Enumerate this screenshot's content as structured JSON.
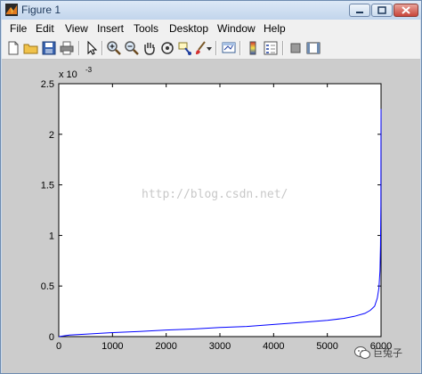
{
  "window": {
    "title": "Figure 1"
  },
  "menu": [
    "File",
    "Edit",
    "View",
    "Insert",
    "Tools",
    "Desktop",
    "Window",
    "Help"
  ],
  "toolbar": [
    "new-figure-icon",
    "open-file-icon",
    "save-icon",
    "print-icon",
    "edit-plot-arrow-icon",
    "zoom-in-icon",
    "zoom-out-icon",
    "pan-hand-icon",
    "rotate-3d-icon",
    "data-cursor-icon",
    "brush-icon",
    "brush-dropdown-icon",
    "link-plot-icon",
    "colorbar-icon",
    "legend-icon",
    "hide-plot-tools-icon",
    "show-plot-tools-icon"
  ],
  "watermark": "http://blog.csdn.net/",
  "brand": {
    "text": "巨兔子"
  },
  "chart_data": {
    "type": "line",
    "title": "",
    "xlabel": "",
    "ylabel": "",
    "y_exponent": "x 10",
    "y_exponent_power": "-3",
    "xlim": [
      0,
      6000
    ],
    "ylim": [
      0,
      2.5
    ],
    "x_ticks": [
      "0",
      "1000",
      "2000",
      "3000",
      "4000",
      "5000",
      "6000"
    ],
    "x_tick_values": [
      0,
      1000,
      2000,
      3000,
      4000,
      5000,
      6000
    ],
    "y_ticks": [
      "0",
      "0.5",
      "1",
      "1.5",
      "2",
      "2.5"
    ],
    "y_tick_values": [
      0,
      0.5,
      1,
      1.5,
      2,
      2.5
    ],
    "grid": false,
    "line_color": "#0000ff",
    "series": [
      {
        "x": [
          1,
          200,
          500,
          1000,
          1500,
          2000,
          2500,
          3000,
          3500,
          4000,
          4500,
          5000,
          5300,
          5500,
          5700,
          5800,
          5880,
          5930,
          5960,
          5980,
          5990,
          5996,
          5998,
          6000
        ],
        "y": [
          0.0,
          0.015,
          0.025,
          0.04,
          0.05,
          0.065,
          0.075,
          0.09,
          0.1,
          0.12,
          0.14,
          0.16,
          0.18,
          0.2,
          0.23,
          0.26,
          0.3,
          0.38,
          0.48,
          0.65,
          0.9,
          1.3,
          1.9,
          2.25
        ]
      }
    ]
  }
}
